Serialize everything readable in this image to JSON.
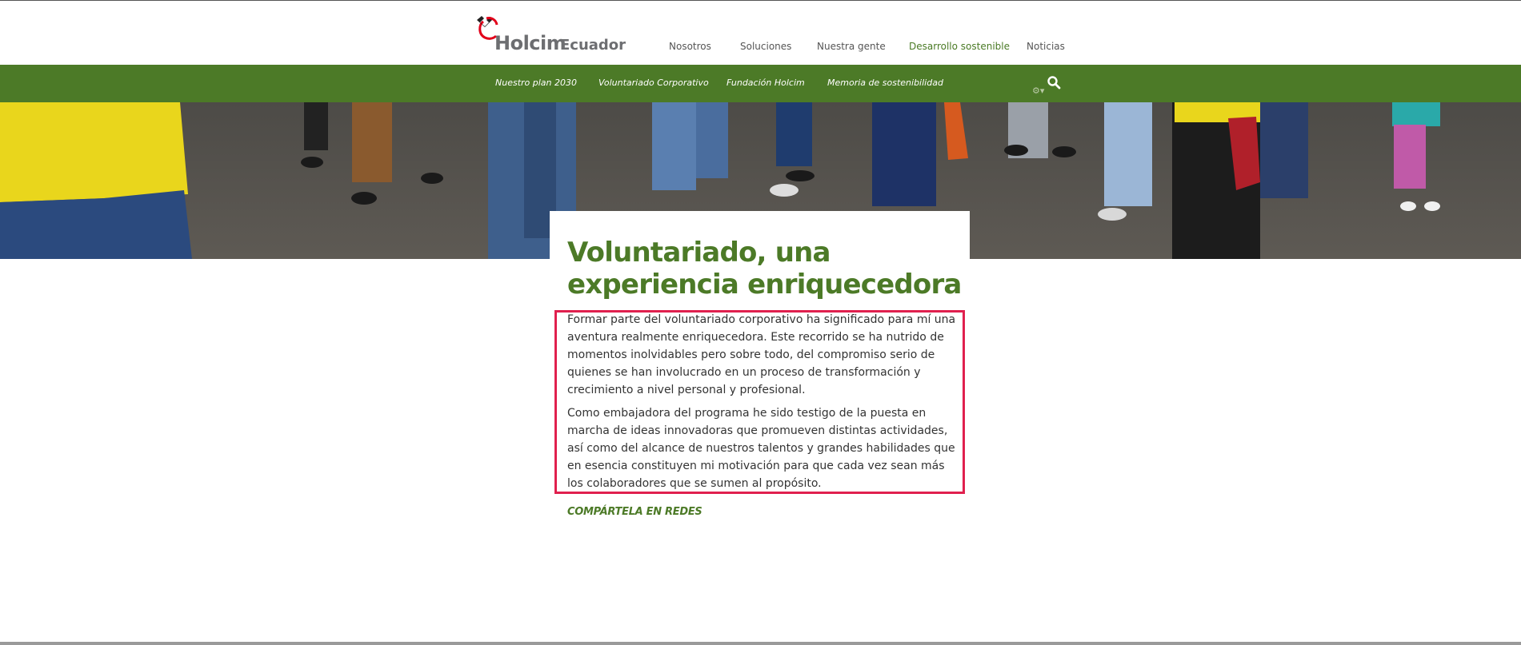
{
  "brand": {
    "name": "Holcim",
    "suffix": "Ecuador",
    "color_primary": "#4c7a27",
    "color_logo_grey": "#6d6e71",
    "color_logo_red": "#e2001a"
  },
  "main_nav": {
    "items": [
      {
        "label": "Nosotros",
        "active": false
      },
      {
        "label": "Soluciones",
        "active": false
      },
      {
        "label": "Nuestra gente",
        "active": false
      },
      {
        "label": "Desarrollo sostenible",
        "active": true
      },
      {
        "label": "Noticias",
        "active": false
      }
    ]
  },
  "sub_nav": {
    "items": [
      {
        "label": "Nuestro plan 2030"
      },
      {
        "label": "Voluntariado Corporativo"
      },
      {
        "label": "Fundación Holcim"
      },
      {
        "label": "Memoria de sostenibilidad"
      }
    ],
    "icons": [
      "gear-icon",
      "search-icon"
    ]
  },
  "article": {
    "title": "Voluntariado, una experiencia enriquecedora",
    "paragraphs": [
      "Formar parte del voluntariado corporativo ha significado para mí una aventura realmente enriquecedora. Este recorrido se ha nutrido de momentos inolvidables pero sobre todo, del compromiso serio de quienes se han involucrado en un proceso de transformación y crecimiento a nivel personal y profesional.",
      "Como embajadora del programa he sido testigo de la puesta en marcha de ideas innovadoras que promueven distintas actividades, así como del alcance de nuestros talentos y grandes habilidades que en esencia constituyen mi motivación para que cada vez sean más los colaboradores que se sumen al propósito."
    ],
    "share_label": "COMPÁRTELA EN REDES",
    "highlight_color": "#e0204e"
  }
}
